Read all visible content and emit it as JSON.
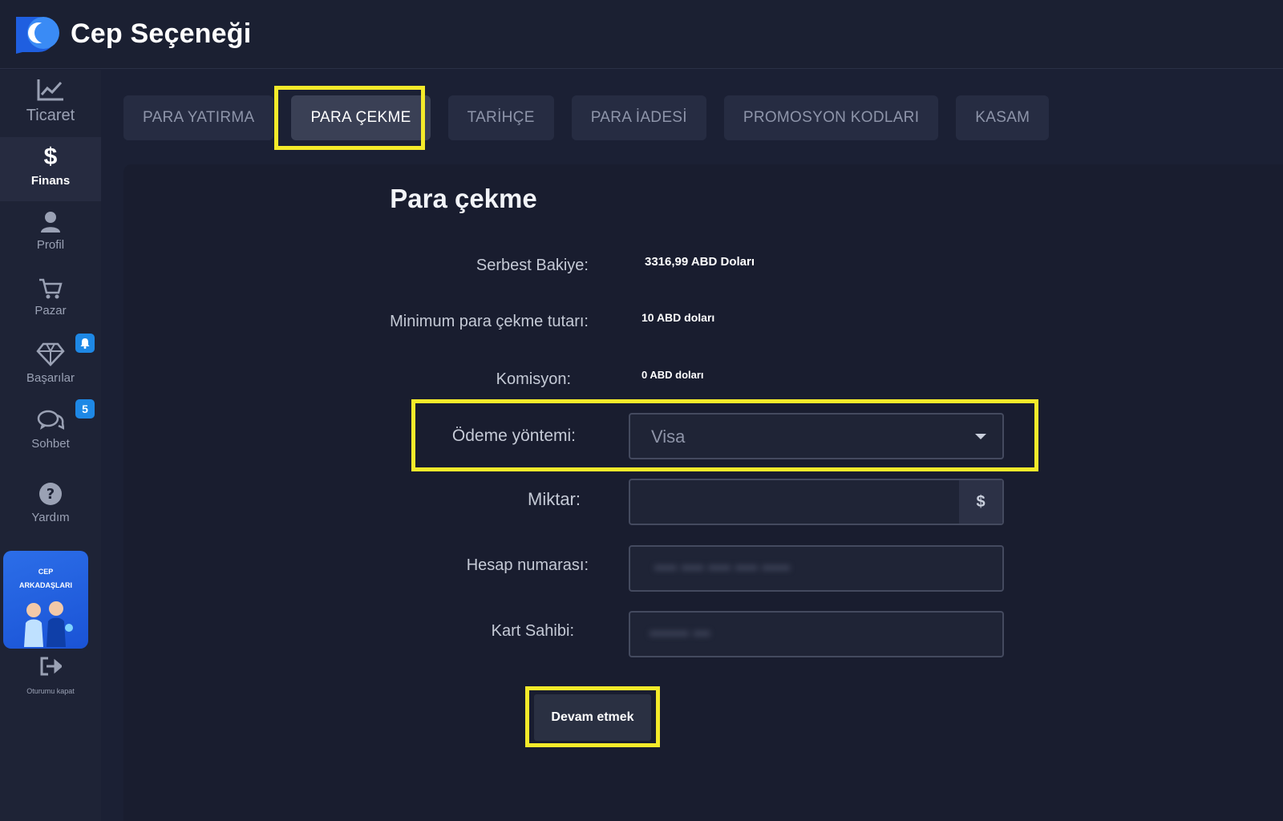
{
  "app": {
    "title": "Cep Seçeneği"
  },
  "sidebar": {
    "items": [
      {
        "label": "Ticaret",
        "icon": "chart-line-icon"
      },
      {
        "label": "Finans",
        "icon": "dollar-icon",
        "active": true
      },
      {
        "label": "Profil",
        "icon": "user-icon"
      },
      {
        "label": "Pazar",
        "icon": "cart-icon"
      },
      {
        "label": "Başarılar",
        "icon": "diamond-icon"
      },
      {
        "label": "Sohbet",
        "icon": "chat-icon",
        "badge": "5"
      },
      {
        "label": "Yardım",
        "icon": "help-icon"
      }
    ],
    "promo": {
      "line1": "CEP",
      "line2": "ARKADAŞLARI"
    },
    "logout": "Oturumu kapat"
  },
  "tabs": [
    {
      "label": "PARA YATIRMA"
    },
    {
      "label": "PARA ÇEKME",
      "active": true
    },
    {
      "label": "TARİHÇE"
    },
    {
      "label": "PARA İADESİ"
    },
    {
      "label": "PROMOSYON KODLARI"
    },
    {
      "label": "KASAM"
    }
  ],
  "form": {
    "title": "Para çekme",
    "free_balance_label": "Serbest Bakiye:",
    "free_balance_value": "3316,99 ABD Doları",
    "min_label": "Minimum para çekme tutarı:",
    "min_value": "10 ABD doları",
    "commission_label": "Komisyon:",
    "commission_value": "0 ABD doları",
    "payment_label": "Ödeme yöntemi:",
    "payment_value": "Visa",
    "amount_label": "Miktar:",
    "amount_currency": "$",
    "account_label": "Hesap numarası:",
    "holder_label": "Kart Sahibi:",
    "submit": "Devam etmek"
  },
  "colors": {
    "highlight": "#f4ea2a",
    "badge": "#1e88e5",
    "promo": "#2c6ee8"
  }
}
